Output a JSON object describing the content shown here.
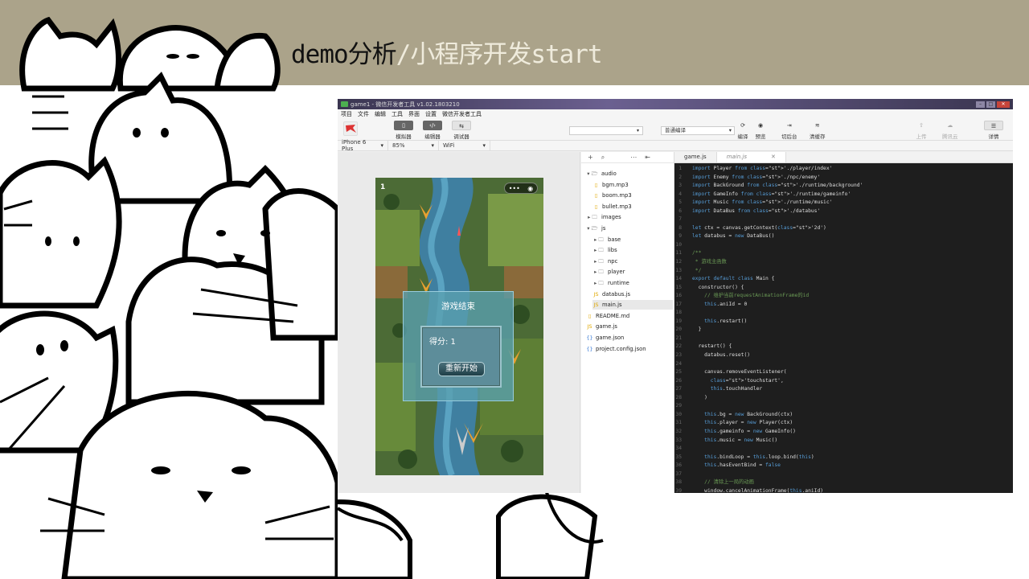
{
  "slide": {
    "title_main": "demo分析",
    "title_sub": "/小程序开发start"
  },
  "colors": {
    "header_band": "#aba38a",
    "accent_sub": "#efebdc"
  },
  "ide": {
    "window_title": "game1 - 微信开发者工具 v1.02.1803210",
    "menu": [
      "项目",
      "文件",
      "编辑",
      "工具",
      "界面",
      "设置",
      "微信开发者工具"
    ],
    "toolbar": {
      "simulator": "模拟器",
      "editor": "编辑器",
      "debugger": "调试器",
      "compile_mode": "普通编译",
      "compile": "编译",
      "preview": "预览",
      "background": "切后台",
      "clear_cache": "清缓存",
      "upload": "上传",
      "test": "腾讯云",
      "details": "详情"
    },
    "subbar": {
      "device": "iPhone 6 Plus",
      "zoom": "85%",
      "network": "WiFi"
    },
    "filetree": [
      {
        "label": "audio",
        "type": "folder-open",
        "depth": 0
      },
      {
        "label": "bgm.mp3",
        "type": "file",
        "depth": 1
      },
      {
        "label": "boom.mp3",
        "type": "file",
        "depth": 1
      },
      {
        "label": "bullet.mp3",
        "type": "file",
        "depth": 1
      },
      {
        "label": "images",
        "type": "folder",
        "depth": 0
      },
      {
        "label": "js",
        "type": "folder-open",
        "depth": 0
      },
      {
        "label": "base",
        "type": "folder",
        "depth": 1
      },
      {
        "label": "libs",
        "type": "folder",
        "depth": 1
      },
      {
        "label": "npc",
        "type": "folder",
        "depth": 1
      },
      {
        "label": "player",
        "type": "folder",
        "depth": 1
      },
      {
        "label": "runtime",
        "type": "folder",
        "depth": 1
      },
      {
        "label": "databus.js",
        "type": "js",
        "depth": 1
      },
      {
        "label": "main.js",
        "type": "js",
        "depth": 1
      },
      {
        "label": "README.md",
        "type": "file",
        "depth": 0
      },
      {
        "label": "game.js",
        "type": "js",
        "depth": 0
      },
      {
        "label": "game.json",
        "type": "json",
        "depth": 0
      },
      {
        "label": "project.config.json",
        "type": "json",
        "depth": 0
      }
    ],
    "tabs": [
      "game.js",
      "main.js"
    ],
    "code": [
      "import Player from './player/index'",
      "import Enemy from './npc/enemy'",
      "import BackGround from './runtime/background'",
      "import GameInfo from './runtime/gameinfo'",
      "import Music from './runtime/music'",
      "import DataBus from './databus'",
      "",
      "let ctx = canvas.getContext('2d')",
      "let databus = new DataBus()",
      "",
      "/**",
      " * 游戏主函数",
      " */",
      "export default class Main {",
      "  constructor() {",
      "    // 维护当前requestAnimationFrame的id",
      "    this.aniId = 0",
      "",
      "    this.restart()",
      "  }",
      "",
      "  restart() {",
      "    databus.reset()",
      "",
      "    canvas.removeEventListener(",
      "      'touchstart',",
      "      this.touchHandler",
      "    )",
      "",
      "    this.bg = new BackGround(ctx)",
      "    this.player = new Player(ctx)",
      "    this.gameinfo = new GameInfo()",
      "    this.music = new Music()",
      "",
      "    this.bindLoop = this.loop.bind(this)",
      "    this.hasEventBind = false",
      "",
      "    // 清除上一局的动画",
      "    window.cancelAnimationFrame(this.aniId)"
    ]
  },
  "game": {
    "score_corner": "1",
    "capsule_dots": "•••",
    "dialog_title": "游戏结束",
    "score_text": "得分: 1",
    "restart_label": "重新开始"
  }
}
